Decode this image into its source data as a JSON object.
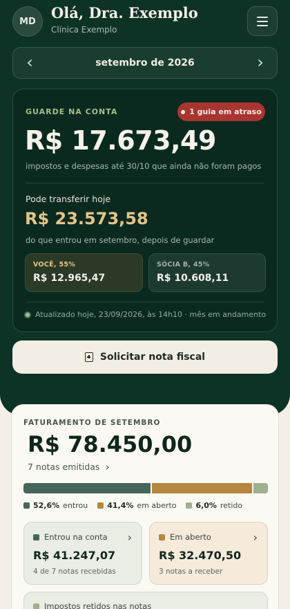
{
  "header": {
    "avatar_initials": "MD",
    "greeting": "Olá, Dra. Exemplo",
    "clinic": "Clínica Exemplo",
    "menu_icon": "hamburger-icon"
  },
  "month_nav": {
    "label": "setembro de 2026",
    "prev_icon": "chevron-left-icon",
    "next_icon": "chevron-right-icon"
  },
  "reserve": {
    "eyebrow": "GUARDE NA CONTA",
    "alert": "1 guia em atraso",
    "amount": "R$ 17.673,49",
    "description": "impostos e despesas até 30/10 que ainda não foram pagos",
    "transfer_label": "Pode transferir hoje",
    "transfer_amount": "R$ 23.573,58",
    "transfer_description": "do que entrou em setembro, depois de guardar",
    "splits": [
      {
        "label": "VOCÊ, 55%",
        "value": "R$ 12.965,47"
      },
      {
        "label": "SÓCIA B, 45%",
        "value": "R$ 10.608,11"
      }
    ],
    "updated": "Atualizado hoje, 23/09/2026, às 14h10 · mês em andamento"
  },
  "request_button": {
    "label": "Solicitar nota fiscal",
    "icon": "document-plus-icon"
  },
  "billing": {
    "eyebrow": "FATURAMENTO DE SETEMBRO",
    "total": "R$ 78.450,00",
    "notes": "7 notas emitidas",
    "breakdown": [
      {
        "percent_label": "52,6%",
        "label": "entrou",
        "fraction": 0.526,
        "color": "#46665a"
      },
      {
        "percent_label": "41,4%",
        "label": "em aberto",
        "fraction": 0.414,
        "color": "#b5873f"
      },
      {
        "percent_label": "6,0%",
        "label": "retido",
        "fraction": 0.06,
        "color": "#9db08f"
      }
    ],
    "received": {
      "title": "Entrou na conta",
      "amount": "R$ 41.247,07",
      "detail": "4 de 7 notas recebidas",
      "color": "#46665a"
    },
    "open": {
      "title": "Em aberto",
      "amount": "R$ 32.470,50",
      "detail": "3 notas a receber",
      "color": "#b5873f"
    },
    "retained": {
      "title": "Impostos retidos nas notas",
      "color": "#9db08f"
    }
  }
}
